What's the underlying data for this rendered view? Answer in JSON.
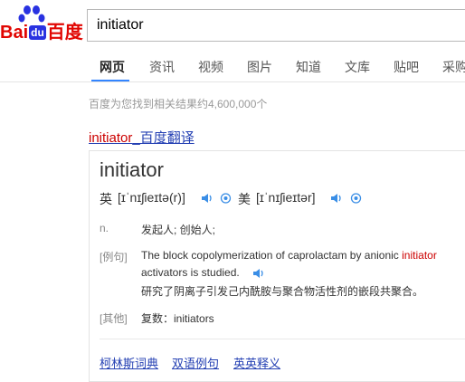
{
  "logo": {
    "bai": "Bai",
    "du": "du",
    "baidu_cn": "百度"
  },
  "search": {
    "value": "initiator"
  },
  "nav": [
    "网页",
    "资讯",
    "视频",
    "图片",
    "知道",
    "文库",
    "贴吧",
    "采购"
  ],
  "result_count": "百度为您找到相关结果约4,600,000个",
  "result": {
    "title_keyword": "initiator",
    "title_rest": "_百度翻译"
  },
  "dict": {
    "word": "initiator",
    "uk_label": "英",
    "uk_phonetic": "[ɪˈnɪʃieɪtə(r)]",
    "us_label": "美",
    "us_phonetic": "[ɪˈnɪʃieɪtər]",
    "pos": "n.",
    "meaning": "发起人; 创始人;",
    "example_tag": "[例句]",
    "example_en_before": "The block copolymerization of caprolactam by anionic ",
    "example_en_keyword": "initiator",
    "example_en_line2": "activators is studied.",
    "example_cn": "研究了阴离子引发己内酰胺与聚合物活性剂的嵌段共聚合。",
    "other_tag": "[其他]",
    "other_text": "复数：initiators",
    "links": [
      "柯林斯词典",
      "双语例句",
      "英英释义"
    ]
  }
}
